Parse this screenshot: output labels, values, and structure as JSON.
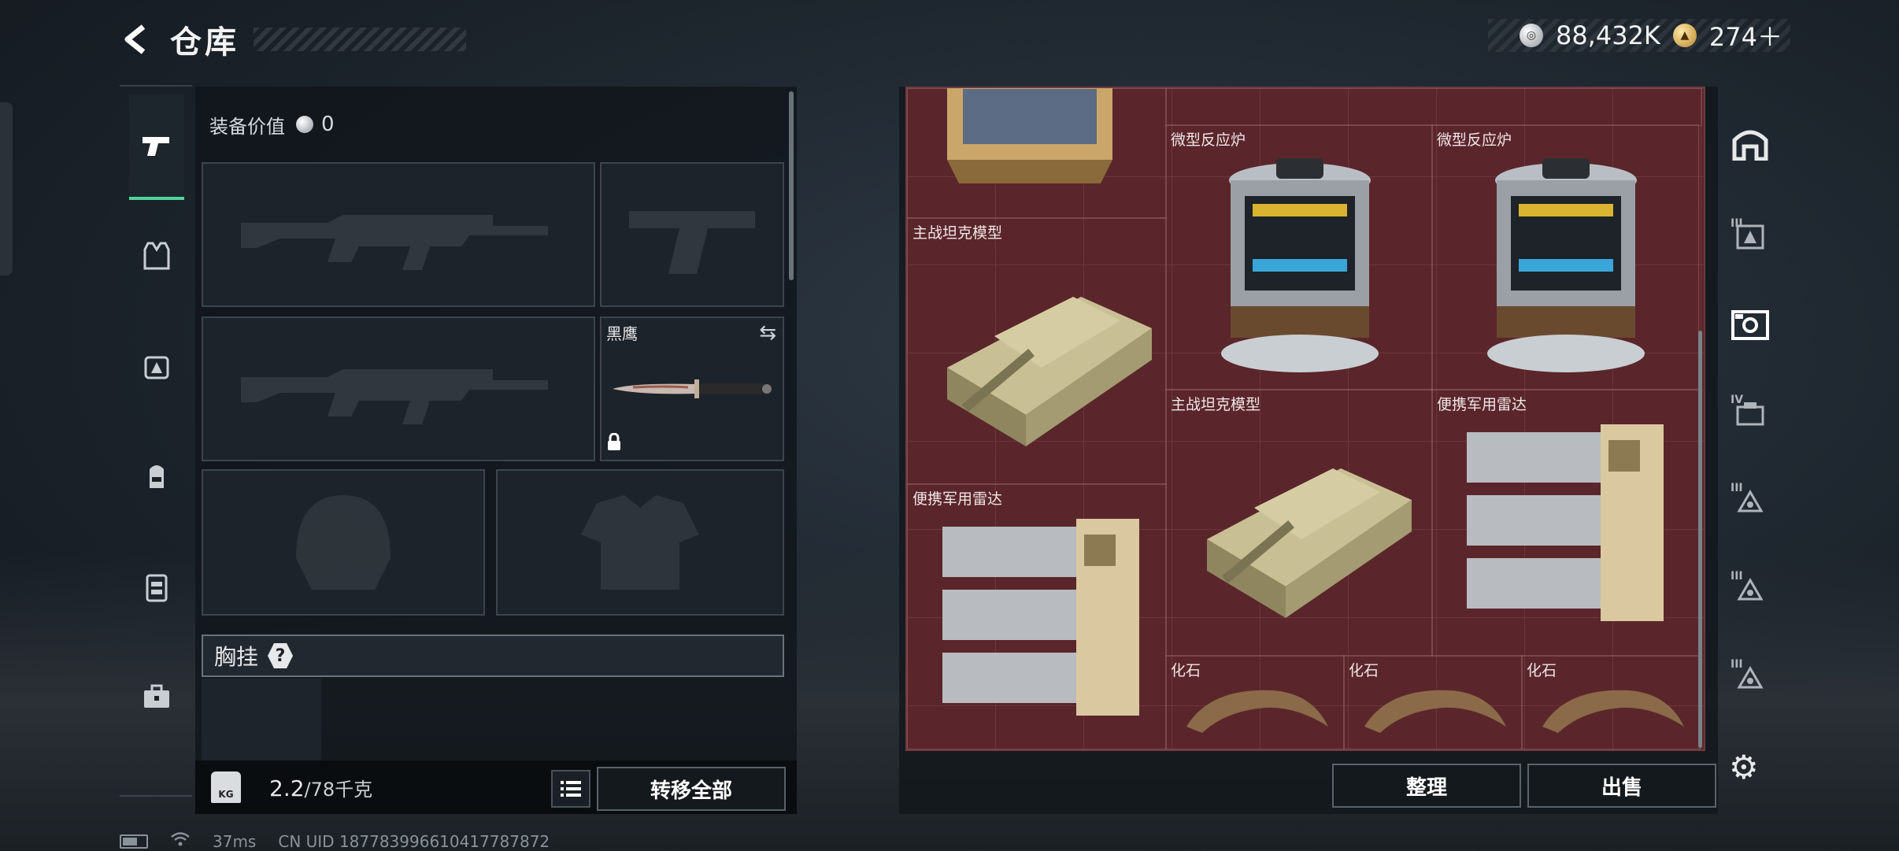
{
  "header": {
    "title": "仓库",
    "back_icon": "back-arrow-icon"
  },
  "currency": {
    "silver_value": "88,432K",
    "gold_value": "274＋"
  },
  "rail": [
    "pistol-icon",
    "vest-icon",
    "medkit-icon",
    "backpack-icon",
    "chest-rig-icon",
    "case-icon"
  ],
  "equipment": {
    "value_label": "装备价值",
    "value": "0",
    "knife_name": "黑鹰",
    "chest_label": "胸挂",
    "chest_help": "?",
    "weight_value": "2.2",
    "weight_capacity": "/78千克",
    "kg_icon_text": "KG",
    "transfer_all": "转移全部"
  },
  "storage": {
    "items": [
      {
        "name": "微型反应炉",
        "kind": "reactor"
      },
      {
        "name": "微型反应炉",
        "kind": "reactor"
      },
      {
        "name": "主战坦克模型",
        "kind": "tank"
      },
      {
        "name": "主战坦克模型",
        "kind": "tank"
      },
      {
        "name": "便携军用雷达",
        "kind": "radar"
      },
      {
        "name": "便携军用雷达",
        "kind": "radar"
      },
      {
        "name": "化石",
        "kind": "fossil"
      },
      {
        "name": "化石",
        "kind": "fossil"
      },
      {
        "name": "化石",
        "kind": "fossil"
      }
    ],
    "sort_label": "整理",
    "sell_label": "出售"
  },
  "tabs": [
    {
      "icon": "home-arch-icon",
      "roman": ""
    },
    {
      "icon": "storage-3-icon",
      "roman": "III"
    },
    {
      "icon": "storage-special-icon",
      "roman": ""
    },
    {
      "icon": "storage-4-icon",
      "roman": "IV"
    },
    {
      "icon": "storage-3b-icon",
      "roman": "III"
    },
    {
      "icon": "storage-3c-icon",
      "roman": "III"
    },
    {
      "icon": "storage-3d-icon",
      "roman": "III"
    }
  ],
  "status": {
    "ping": "37ms",
    "uid": "CN UID 18778399661041778787​2"
  }
}
